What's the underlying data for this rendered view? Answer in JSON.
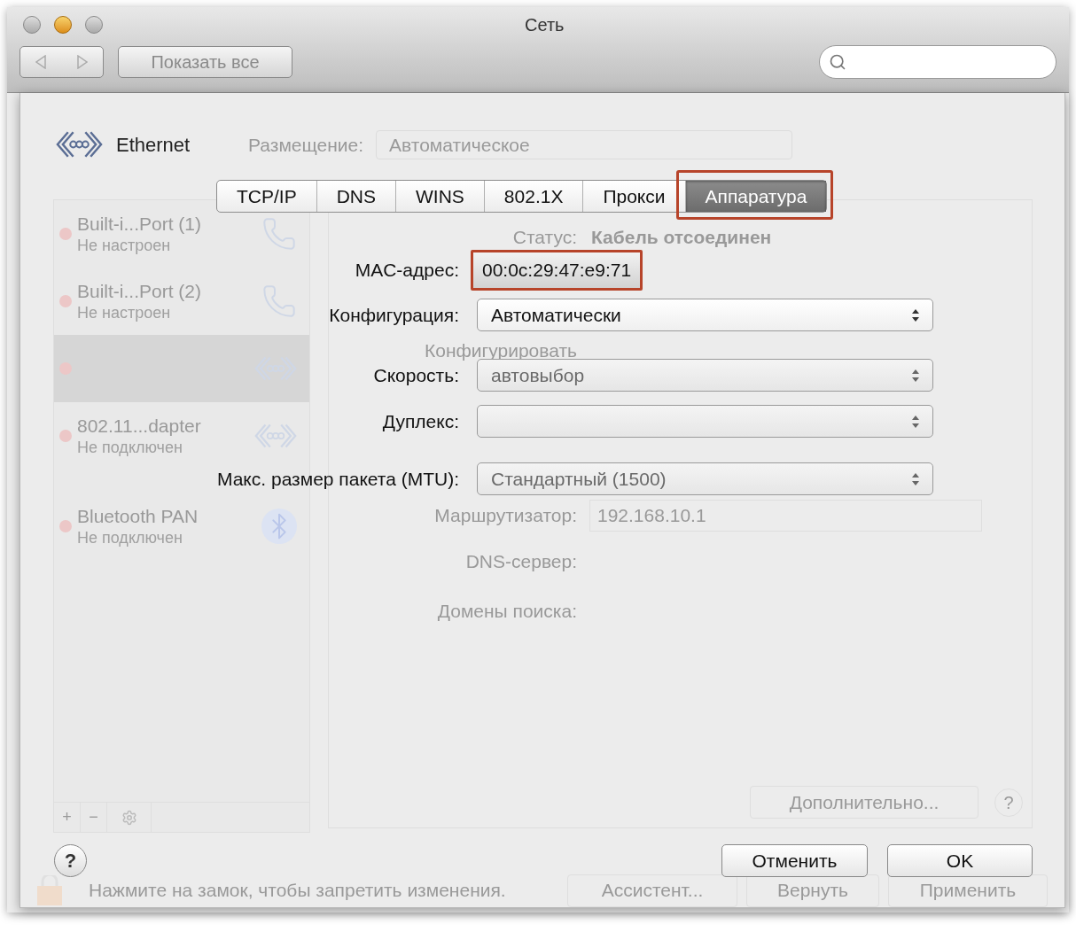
{
  "window": {
    "title": "Сеть",
    "show_all_button": "Показать все"
  },
  "location": {
    "label": "Размещение:",
    "value": "Автоматическое"
  },
  "sidebar": {
    "items": [
      {
        "kind": "modem",
        "name": "Built-i...Port (1)",
        "status": "Не настроен",
        "selected": false
      },
      {
        "kind": "modem",
        "name": "Built-i...Port (2)",
        "status": "Не настроен",
        "selected": false
      },
      {
        "kind": "ethernet",
        "selected": true
      },
      {
        "kind": "ethernet",
        "name": "802.11...dapter",
        "status": "Не подключен",
        "selected": false
      },
      {
        "kind": "bluetooth",
        "name": "Bluetooth PAN",
        "status": "Не подключен",
        "selected": false
      }
    ],
    "buttons": [
      "+",
      "−"
    ]
  },
  "details": {
    "status_label": "Статус:",
    "status_value": "Кабель отсоединен",
    "configure_label": "Конфигурировать",
    "router_label": "Маршрутизатор:",
    "router_value": "192.168.10.1",
    "dns_label": "DNS-сервер:",
    "domains_label": "Домены поиска:",
    "advanced_button": "Дополнительно...",
    "help_button": "?"
  },
  "bottom_bar": {
    "lock_text": "Нажмите на замок, чтобы запретить изменения.",
    "buttons": [
      "Ассистент...",
      "Вернуть",
      "Применить"
    ]
  },
  "sheet": {
    "interface": "Ethernet",
    "tabs": [
      {
        "label": "TCP/IP",
        "selected": false,
        "highlighted": false
      },
      {
        "label": "DNS",
        "selected": false,
        "highlighted": false
      },
      {
        "label": "WINS",
        "selected": false,
        "highlighted": false
      },
      {
        "label": "802.1X",
        "selected": false,
        "highlighted": false
      },
      {
        "label": "Прокси",
        "selected": false,
        "highlighted": false
      },
      {
        "label": "Аппаратура",
        "selected": true,
        "highlighted": true
      }
    ],
    "mac": {
      "label": "MAC-адрес:",
      "value": "00:0c:29:47:e9:71",
      "highlighted": true
    },
    "fields": [
      {
        "label": "Конфигурация:",
        "value": "Автоматически",
        "disabled": false
      },
      {
        "label": "Скорость:",
        "value": "автовыбор",
        "disabled": true
      },
      {
        "label": "Дуплекс:",
        "disabled": true
      },
      {
        "label": "Макс. размер пакета (MTU):",
        "value": "Стандартный (1500)",
        "disabled": true
      }
    ],
    "help_button": "?",
    "cancel_button": "Отменить",
    "ok_button": "OK"
  }
}
